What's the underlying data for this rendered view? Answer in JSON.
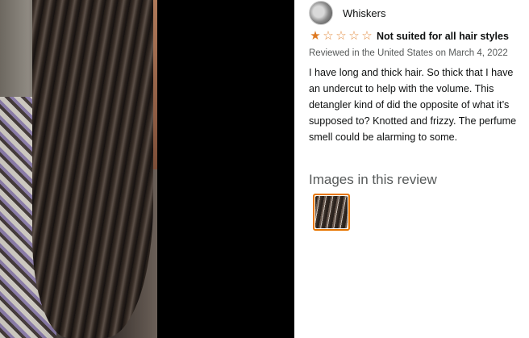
{
  "reviewer": {
    "name": "Whiskers"
  },
  "review": {
    "rating": 1,
    "max_rating": 5,
    "title": "Not suited for all hair styles",
    "meta": "Reviewed in the United States on March 4, 2022",
    "body": "I have long and thick hair. So thick that I have an undercut to help with the volume. This detangler kind of did the opposite of what it’s supposed to? Knotted and frizzy. The perfume smell could be alarming to some."
  },
  "images_section": {
    "heading": "Images in this review"
  },
  "colors": {
    "star": "#de7921",
    "thumb_border": "#e77600",
    "text": "#0f1111",
    "meta_text": "#565959"
  }
}
